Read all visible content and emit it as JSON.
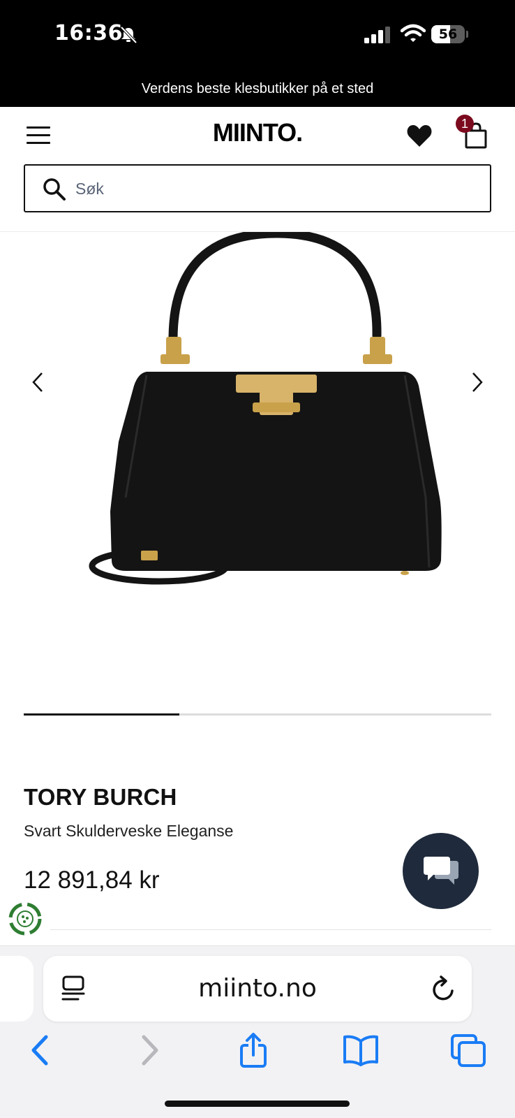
{
  "status_bar": {
    "time": "16:36",
    "battery_level": "56",
    "battery_fraction": 0.56
  },
  "promo": {
    "text": "Verdens beste klesbutikker på et sted"
  },
  "header": {
    "logo": "MIINTO.",
    "cart_count": "1",
    "icons": [
      "menu-icon",
      "heart-icon",
      "shopping-bag-icon"
    ]
  },
  "search": {
    "placeholder": "Søk"
  },
  "gallery": {
    "image": "black-handbag-photo",
    "current_position_fraction": 0.333
  },
  "product": {
    "brand": "TORY BURCH",
    "name": "Svart Skulderveske Eleganse",
    "price": "12 891,84 kr"
  },
  "browser": {
    "url": "miinto.no",
    "icons": [
      "reader-icon",
      "reload-icon",
      "back-icon",
      "forward-icon",
      "share-icon",
      "bookmarks-icon",
      "tabs-icon"
    ]
  },
  "colors": {
    "badge": "#7c0a1e",
    "chat_button": "#1f2a3c",
    "ios_blue": "#1a7cf5",
    "eco_green": "#2e7d32"
  }
}
